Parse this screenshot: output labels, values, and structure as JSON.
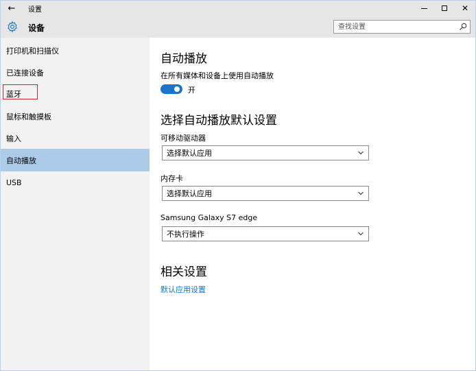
{
  "window": {
    "title": "设置",
    "back_glyph": "←",
    "close_glyph": "✕"
  },
  "header": {
    "title": "设备",
    "icon": "gear-icon",
    "search_placeholder": "查找设置"
  },
  "sidebar": {
    "items": [
      {
        "label": "打印机和扫描仪"
      },
      {
        "label": "已连接设备"
      },
      {
        "label": "蓝牙"
      },
      {
        "label": "鼠标和触摸板"
      },
      {
        "label": "输入"
      },
      {
        "label": "自动播放"
      },
      {
        "label": "USB"
      }
    ],
    "selected_label": "自动播放",
    "highlighted_label": "蓝牙"
  },
  "main": {
    "autoplay": {
      "heading": "自动播放",
      "toggle_label": "在所有媒体和设备上使用自动播放",
      "toggle_state": "开",
      "toggle_on": true
    },
    "defaults": {
      "heading": "选择自动播放默认设置",
      "removable_drive": {
        "label": "可移动驱动器",
        "value": "选择默认应用"
      },
      "memory_card": {
        "label": "内存卡",
        "value": "选择默认应用"
      },
      "galaxy": {
        "label": "Samsung Galaxy S7 edge",
        "value": "不执行操作"
      }
    },
    "related": {
      "heading": "相关设置",
      "link": "默认应用设置"
    }
  },
  "colors": {
    "accent": "#1b74c9",
    "selected_bg": "#abcbe8",
    "highlight_border": "#c0282d",
    "link": "#1a73c8"
  }
}
